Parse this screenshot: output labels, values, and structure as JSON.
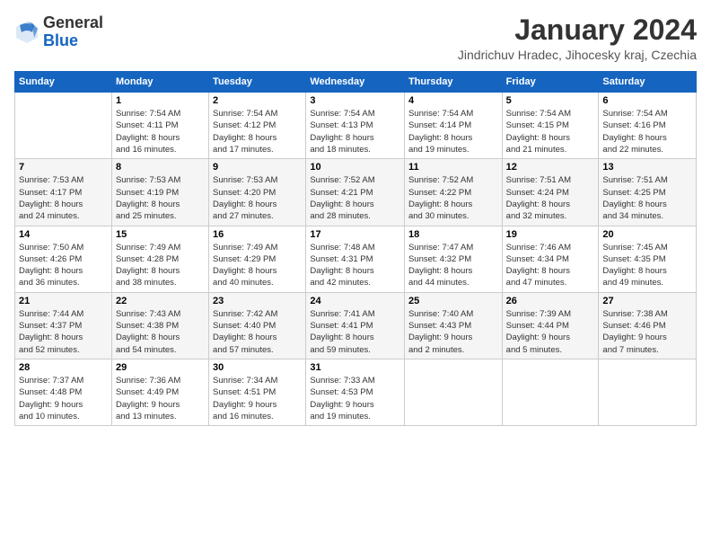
{
  "logo": {
    "general": "General",
    "blue": "Blue"
  },
  "header": {
    "month": "January 2024",
    "subtitle": "Jindrichuv Hradec, Jihocesky kraj, Czechia"
  },
  "days_of_week": [
    "Sunday",
    "Monday",
    "Tuesday",
    "Wednesday",
    "Thursday",
    "Friday",
    "Saturday"
  ],
  "weeks": [
    [
      {
        "day": "",
        "content": ""
      },
      {
        "day": "1",
        "content": "Sunrise: 7:54 AM\nSunset: 4:11 PM\nDaylight: 8 hours\nand 16 minutes."
      },
      {
        "day": "2",
        "content": "Sunrise: 7:54 AM\nSunset: 4:12 PM\nDaylight: 8 hours\nand 17 minutes."
      },
      {
        "day": "3",
        "content": "Sunrise: 7:54 AM\nSunset: 4:13 PM\nDaylight: 8 hours\nand 18 minutes."
      },
      {
        "day": "4",
        "content": "Sunrise: 7:54 AM\nSunset: 4:14 PM\nDaylight: 8 hours\nand 19 minutes."
      },
      {
        "day": "5",
        "content": "Sunrise: 7:54 AM\nSunset: 4:15 PM\nDaylight: 8 hours\nand 21 minutes."
      },
      {
        "day": "6",
        "content": "Sunrise: 7:54 AM\nSunset: 4:16 PM\nDaylight: 8 hours\nand 22 minutes."
      }
    ],
    [
      {
        "day": "7",
        "content": "Sunrise: 7:53 AM\nSunset: 4:17 PM\nDaylight: 8 hours\nand 24 minutes."
      },
      {
        "day": "8",
        "content": "Sunrise: 7:53 AM\nSunset: 4:19 PM\nDaylight: 8 hours\nand 25 minutes."
      },
      {
        "day": "9",
        "content": "Sunrise: 7:53 AM\nSunset: 4:20 PM\nDaylight: 8 hours\nand 27 minutes."
      },
      {
        "day": "10",
        "content": "Sunrise: 7:52 AM\nSunset: 4:21 PM\nDaylight: 8 hours\nand 28 minutes."
      },
      {
        "day": "11",
        "content": "Sunrise: 7:52 AM\nSunset: 4:22 PM\nDaylight: 8 hours\nand 30 minutes."
      },
      {
        "day": "12",
        "content": "Sunrise: 7:51 AM\nSunset: 4:24 PM\nDaylight: 8 hours\nand 32 minutes."
      },
      {
        "day": "13",
        "content": "Sunrise: 7:51 AM\nSunset: 4:25 PM\nDaylight: 8 hours\nand 34 minutes."
      }
    ],
    [
      {
        "day": "14",
        "content": "Sunrise: 7:50 AM\nSunset: 4:26 PM\nDaylight: 8 hours\nand 36 minutes."
      },
      {
        "day": "15",
        "content": "Sunrise: 7:49 AM\nSunset: 4:28 PM\nDaylight: 8 hours\nand 38 minutes."
      },
      {
        "day": "16",
        "content": "Sunrise: 7:49 AM\nSunset: 4:29 PM\nDaylight: 8 hours\nand 40 minutes."
      },
      {
        "day": "17",
        "content": "Sunrise: 7:48 AM\nSunset: 4:31 PM\nDaylight: 8 hours\nand 42 minutes."
      },
      {
        "day": "18",
        "content": "Sunrise: 7:47 AM\nSunset: 4:32 PM\nDaylight: 8 hours\nand 44 minutes."
      },
      {
        "day": "19",
        "content": "Sunrise: 7:46 AM\nSunset: 4:34 PM\nDaylight: 8 hours\nand 47 minutes."
      },
      {
        "day": "20",
        "content": "Sunrise: 7:45 AM\nSunset: 4:35 PM\nDaylight: 8 hours\nand 49 minutes."
      }
    ],
    [
      {
        "day": "21",
        "content": "Sunrise: 7:44 AM\nSunset: 4:37 PM\nDaylight: 8 hours\nand 52 minutes."
      },
      {
        "day": "22",
        "content": "Sunrise: 7:43 AM\nSunset: 4:38 PM\nDaylight: 8 hours\nand 54 minutes."
      },
      {
        "day": "23",
        "content": "Sunrise: 7:42 AM\nSunset: 4:40 PM\nDaylight: 8 hours\nand 57 minutes."
      },
      {
        "day": "24",
        "content": "Sunrise: 7:41 AM\nSunset: 4:41 PM\nDaylight: 8 hours\nand 59 minutes."
      },
      {
        "day": "25",
        "content": "Sunrise: 7:40 AM\nSunset: 4:43 PM\nDaylight: 9 hours\nand 2 minutes."
      },
      {
        "day": "26",
        "content": "Sunrise: 7:39 AM\nSunset: 4:44 PM\nDaylight: 9 hours\nand 5 minutes."
      },
      {
        "day": "27",
        "content": "Sunrise: 7:38 AM\nSunset: 4:46 PM\nDaylight: 9 hours\nand 7 minutes."
      }
    ],
    [
      {
        "day": "28",
        "content": "Sunrise: 7:37 AM\nSunset: 4:48 PM\nDaylight: 9 hours\nand 10 minutes."
      },
      {
        "day": "29",
        "content": "Sunrise: 7:36 AM\nSunset: 4:49 PM\nDaylight: 9 hours\nand 13 minutes."
      },
      {
        "day": "30",
        "content": "Sunrise: 7:34 AM\nSunset: 4:51 PM\nDaylight: 9 hours\nand 16 minutes."
      },
      {
        "day": "31",
        "content": "Sunrise: 7:33 AM\nSunset: 4:53 PM\nDaylight: 9 hours\nand 19 minutes."
      },
      {
        "day": "",
        "content": ""
      },
      {
        "day": "",
        "content": ""
      },
      {
        "day": "",
        "content": ""
      }
    ]
  ]
}
